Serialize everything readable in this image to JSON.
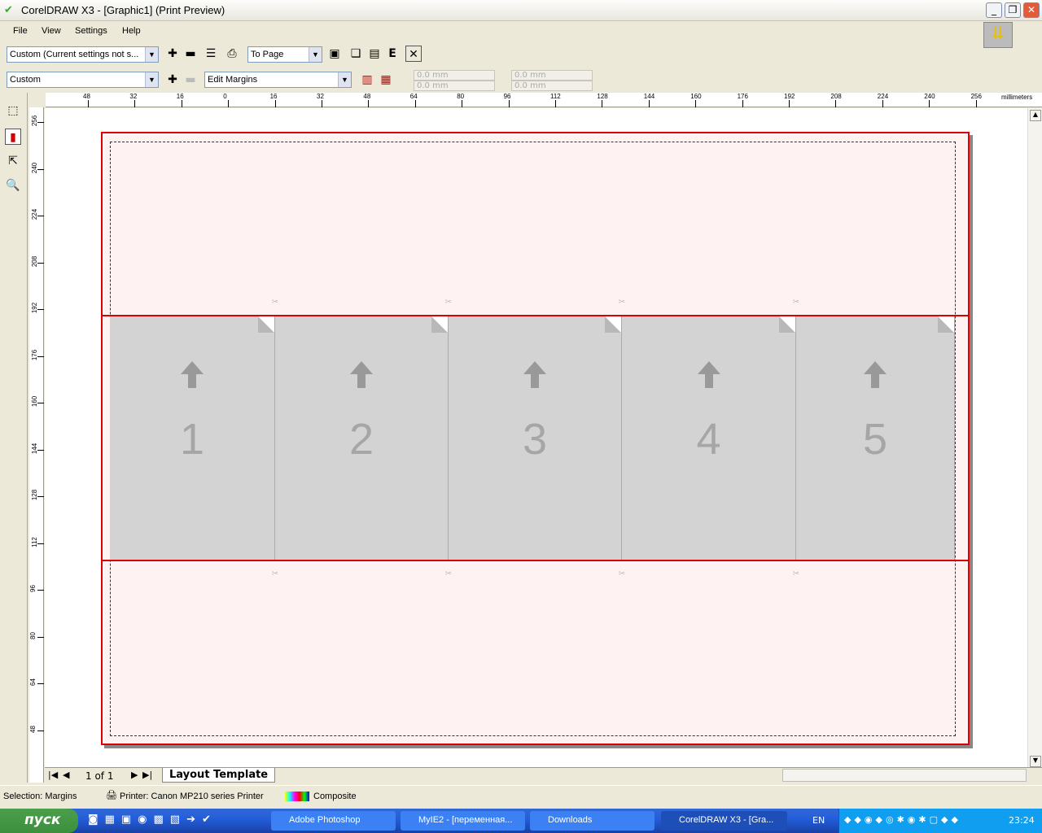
{
  "window": {
    "title": "CorelDRAW X3 - [Graphic1] (Print Preview)"
  },
  "menu": [
    "File",
    "View",
    "Settings",
    "Help"
  ],
  "toolbar1": {
    "preset": "Custom (Current settings not s...",
    "zoom": "To Page"
  },
  "toolbar2": {
    "layout": "Custom",
    "mode": "Edit Margins",
    "fields": [
      "0.0 mm",
      "0.0 mm",
      "0.0 mm",
      "0.0 mm"
    ]
  },
  "ruler": {
    "top_labels": [
      "48",
      "32",
      "16",
      "0",
      "16",
      "32",
      "48",
      "64",
      "80",
      "96",
      "112",
      "128",
      "144",
      "160",
      "176",
      "192",
      "208",
      "224",
      "240",
      "256"
    ],
    "unit": "millimeters",
    "left_labels": [
      "256",
      "240",
      "224",
      "208",
      "192",
      "176",
      "160",
      "144",
      "128",
      "112",
      "96",
      "80",
      "64",
      "48"
    ]
  },
  "panels": [
    "1",
    "2",
    "3",
    "4",
    "5"
  ],
  "pager": {
    "text": "1 of 1",
    "tab": "Layout Template"
  },
  "status": {
    "selection": "Selection: Margins",
    "printer": "Printer: Canon MP210 series Printer",
    "color_mode": "Composite"
  },
  "taskbar": {
    "start": "пуск",
    "tasks": [
      "Adobe Photoshop",
      "MyIE2 - [переменная...",
      "Downloads",
      "CorelDRAW X3 - [Gra..."
    ],
    "lang": "EN",
    "clock": "23:24"
  }
}
